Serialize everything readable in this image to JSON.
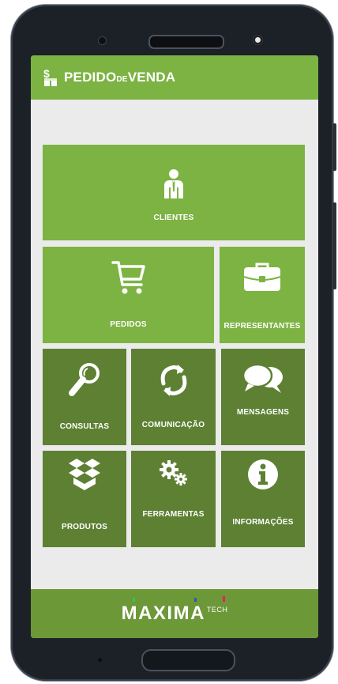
{
  "app": {
    "logo_main": "PEDIDO",
    "logo_de": "DE",
    "logo_end": "VENDA"
  },
  "menu": {
    "clientes": "CLIENTES",
    "pedidos": "PEDIDOS",
    "representantes": "REPRESENTANTES",
    "consultas": "CONSULTAS",
    "comunicacao": "COMUNICAÇÃO",
    "mensagens": "MENSAGENS",
    "produtos": "PRODUTOS",
    "ferramentas": "FERRAMENTAS",
    "informacoes": "INFORMAÇÕES"
  },
  "footer": {
    "brand": "MAXIMA",
    "brand_sub": "TECH"
  },
  "colors": {
    "tile_light": "#7cb342",
    "tile_dark": "#5d8033",
    "footer": "#6c9838",
    "background": "#ebebeb"
  },
  "icons": [
    "user-icon",
    "cart-icon",
    "briefcase-icon",
    "magnify-icon",
    "sync-icon",
    "chat-icon",
    "box-icon",
    "gears-icon",
    "info-icon"
  ]
}
